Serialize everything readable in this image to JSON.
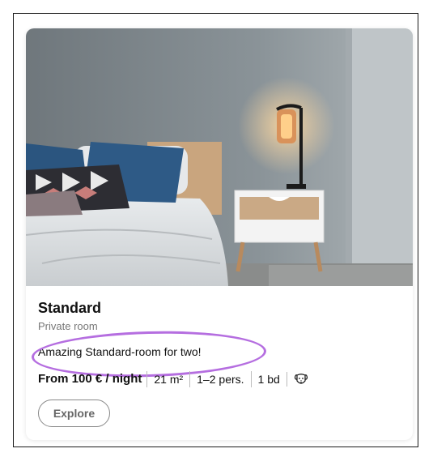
{
  "room": {
    "title": "Standard",
    "subtitle": "Private room",
    "description": "Amazing Standard-room for two!",
    "price": "From 100 € / night",
    "area": "21 m²",
    "guests": "1–2 pers.",
    "beds": "1 bd",
    "pet_icon": "dog-icon",
    "explore_label": "Explore",
    "image_description": "bedroom-photo"
  },
  "colors": {
    "highlight": "#b56ee0"
  }
}
